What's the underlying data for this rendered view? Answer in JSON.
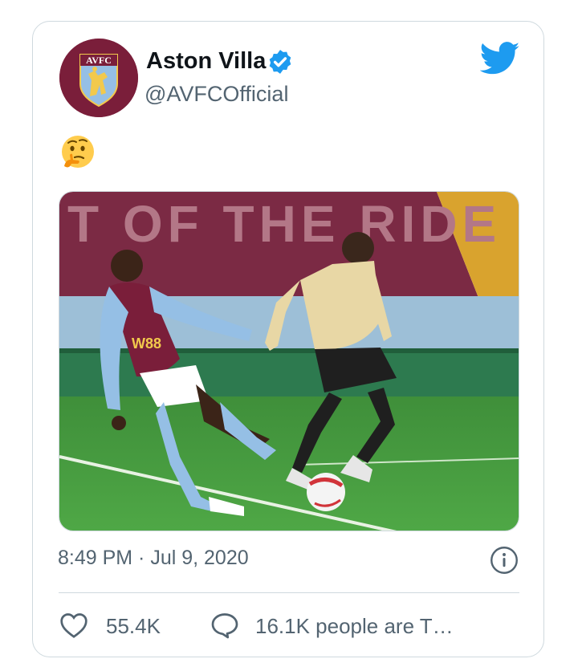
{
  "tweet": {
    "display_name": "Aston Villa",
    "handle": "@AVFCOfficial",
    "verified": true,
    "avatar_crest_text": "AVFC",
    "body_emoji": "thinking-face",
    "media": {
      "banner_text": "T OF THE RIDE",
      "home_shirt_sponsor": "W88"
    },
    "timestamp": "8:49 PM · Jul 9, 2020",
    "likes": "55.4K",
    "conversation": "16.1K people are T…"
  },
  "icons": {
    "verified": "verified-badge-icon",
    "platform": "twitter-bird-icon",
    "info": "info-icon",
    "like": "heart-icon",
    "reply": "speech-bubble-icon"
  },
  "colors": {
    "brand_blue": "#1d9bf0",
    "text_primary": "#0f1419",
    "text_secondary": "#536471",
    "border": "#cfd9de",
    "villa_claret": "#7a1e3a",
    "villa_blue": "#95bfe5"
  }
}
